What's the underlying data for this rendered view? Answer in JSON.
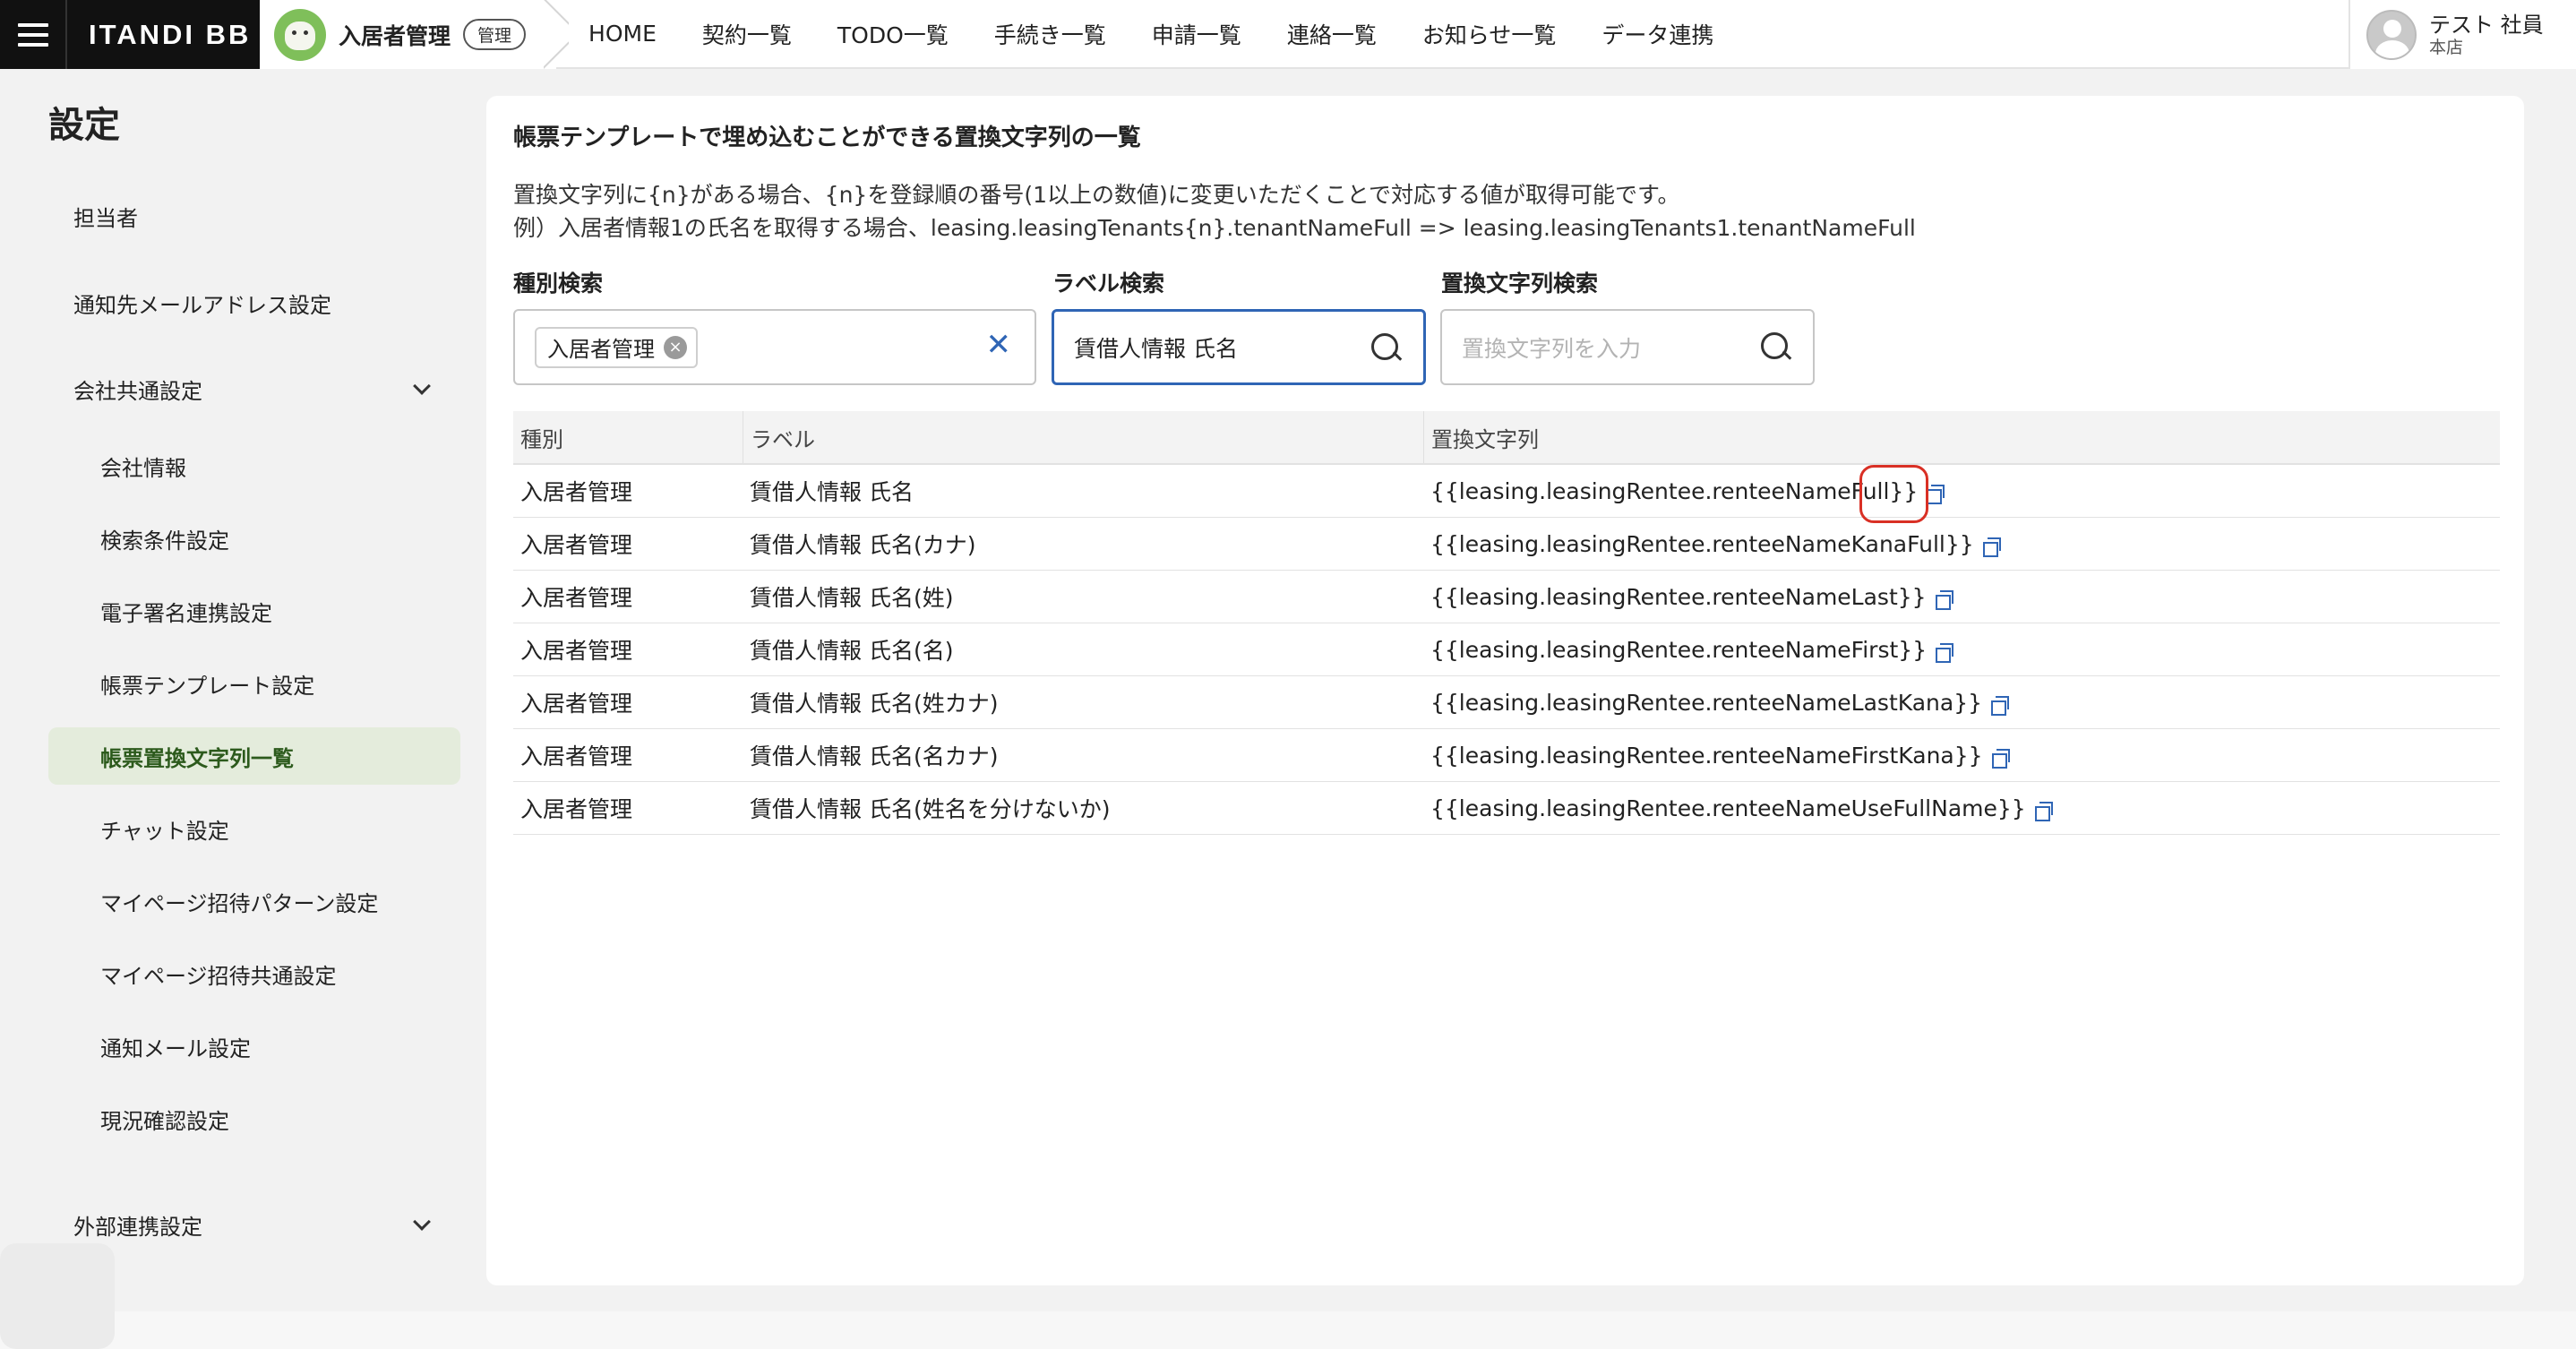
{
  "header": {
    "brand": "ITANDI BB",
    "product_name": "入居者管理",
    "product_badge": "管理",
    "nav": [
      "HOME",
      "契約一覧",
      "TODO一覧",
      "手続き一覧",
      "申請一覧",
      "連絡一覧",
      "お知らせ一覧",
      "データ連携"
    ],
    "user_name": "テスト 社員",
    "user_branch": "本店"
  },
  "sidebar": {
    "title": "設定",
    "items": [
      {
        "label": "担当者",
        "level": 1
      },
      {
        "label": "通知先メールアドレス設定",
        "level": 1
      },
      {
        "label": "会社共通設定",
        "level": 1,
        "expandable": true
      },
      {
        "label": "会社情報",
        "level": 2
      },
      {
        "label": "検索条件設定",
        "level": 2
      },
      {
        "label": "電子署名連携設定",
        "level": 2
      },
      {
        "label": "帳票テンプレート設定",
        "level": 2
      },
      {
        "label": "帳票置換文字列一覧",
        "level": 2,
        "active": true
      },
      {
        "label": "チャット設定",
        "level": 2
      },
      {
        "label": "マイページ招待パターン設定",
        "level": 2
      },
      {
        "label": "マイページ招待共通設定",
        "level": 2
      },
      {
        "label": "通知メール設定",
        "level": 2
      },
      {
        "label": "現況確認設定",
        "level": 2
      },
      {
        "label": "外部連携設定",
        "level": 1,
        "expandable": true
      }
    ]
  },
  "main": {
    "title": "帳票テンプレートで埋め込むことができる置換文字列の一覧",
    "desc_line1": "置換文字列に{n}がある場合、{n}を登録順の番号(1以上の数値)に変更いただくことで対応する値が取得可能です。",
    "desc_line2": "例）入居者情報1の氏名を取得する場合、leasing.leasingTenants{n}.tenantNameFull => leasing.leasingTenants1.tenantNameFull",
    "filters": {
      "type_label": "種別検索",
      "type_chip": "入居者管理",
      "label_label": "ラベル検索",
      "label_value": "賃借人情報 氏名",
      "replace_label": "置換文字列検索",
      "replace_placeholder": "置換文字列を入力"
    },
    "table": {
      "headers": [
        "種別",
        "ラベル",
        "置換文字列"
      ],
      "rows": [
        [
          "入居者管理",
          "賃借人情報 氏名",
          "{{leasing.leasingRentee.renteeNameFull}}"
        ],
        [
          "入居者管理",
          "賃借人情報 氏名(カナ)",
          "{{leasing.leasingRentee.renteeNameKanaFull}}"
        ],
        [
          "入居者管理",
          "賃借人情報 氏名(姓)",
          "{{leasing.leasingRentee.renteeNameLast}}"
        ],
        [
          "入居者管理",
          "賃借人情報 氏名(名)",
          "{{leasing.leasingRentee.renteeNameFirst}}"
        ],
        [
          "入居者管理",
          "賃借人情報 氏名(姓カナ)",
          "{{leasing.leasingRentee.renteeNameLastKana}}"
        ],
        [
          "入居者管理",
          "賃借人情報 氏名(名カナ)",
          "{{leasing.leasingRentee.renteeNameFirstKana}}"
        ],
        [
          "入居者管理",
          "賃借人情報 氏名(姓名を分けないか)",
          "{{leasing.leasingRentee.renteeNameUseFullName}}"
        ]
      ]
    }
  },
  "colors": {
    "accent": "#2f65b5",
    "active_bg": "#e4ecdc",
    "highlight": "#d93025"
  }
}
